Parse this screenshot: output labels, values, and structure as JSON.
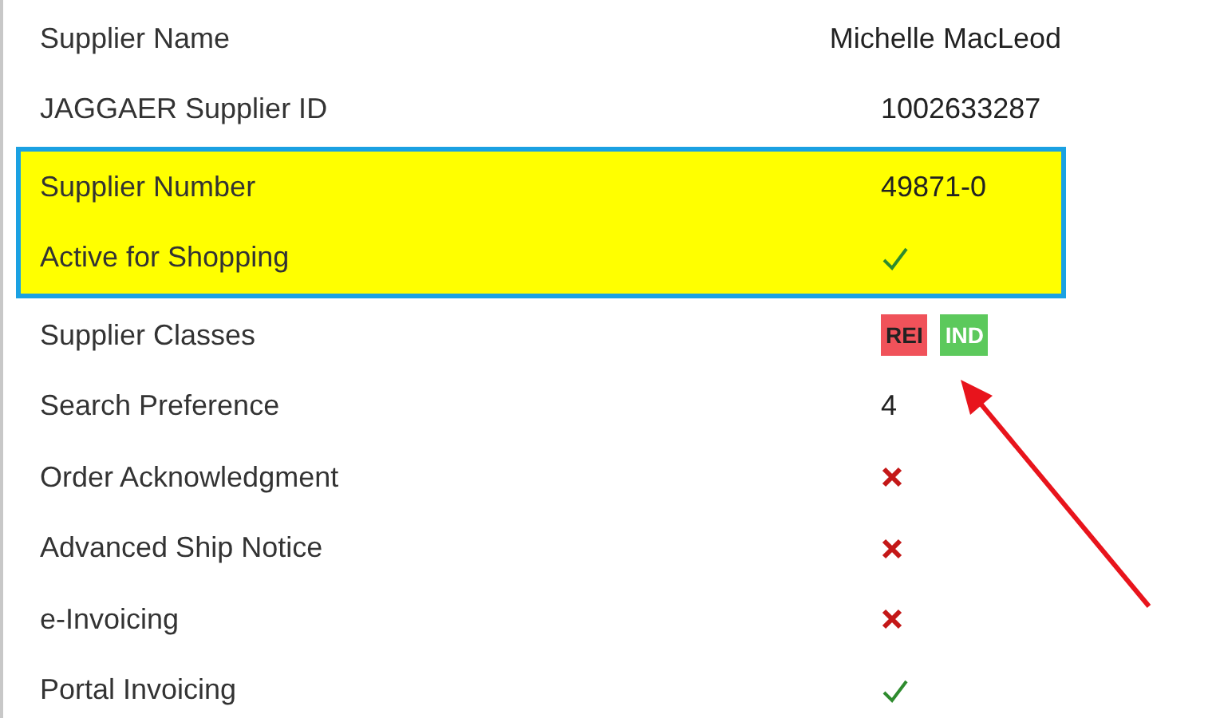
{
  "sections": [
    {
      "highlighted": false,
      "fields": [
        {
          "label": "Supplier Name",
          "kind": "text",
          "value": "Michelle MacLeod"
        },
        {
          "label": "JAGGAER Supplier ID",
          "kind": "text",
          "value": "1002633287"
        }
      ]
    },
    {
      "highlighted": true,
      "fields": [
        {
          "label": "Supplier Number",
          "kind": "text",
          "value": "49871-0"
        },
        {
          "label": "Active for Shopping",
          "kind": "flag",
          "checked": true
        }
      ]
    },
    {
      "highlighted": false,
      "fields": [
        {
          "label": "Supplier Classes",
          "kind": "badges",
          "badges": [
            {
              "text": "REI",
              "color": "#f0525a"
            },
            {
              "text": "IND",
              "color": "#5cc95c"
            }
          ]
        },
        {
          "label": "Search Preference",
          "kind": "text",
          "value": "4"
        },
        {
          "label": "Order Acknowledgment",
          "kind": "flag",
          "checked": false
        },
        {
          "label": "Advanced Ship Notice",
          "kind": "flag",
          "checked": false
        },
        {
          "label": "e-Invoicing",
          "kind": "flag",
          "checked": false
        },
        {
          "label": "Portal Invoicing",
          "kind": "flag",
          "checked": true
        }
      ]
    }
  ]
}
